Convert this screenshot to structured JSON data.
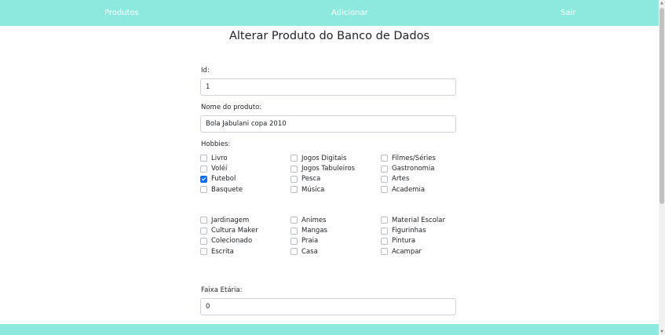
{
  "nav": {
    "produtos": "Produtos",
    "adicionar": "Adicionar",
    "sair": "Sair"
  },
  "page": {
    "title": "Alterar Produto do Banco de Dados"
  },
  "form": {
    "id_label": "Id:",
    "id_value": "1",
    "name_label": "Nome do produto:",
    "name_value": "Bola Jabulani copa 2010",
    "hobbies_label": "Hobbies:",
    "age_label": "Faixa Etária:",
    "age_value": "0"
  },
  "hobbies_group1": {
    "col1": [
      {
        "label": "Livro",
        "checked": false
      },
      {
        "label": "Voléi",
        "checked": false
      },
      {
        "label": "Futebol",
        "checked": true
      },
      {
        "label": "Basquete",
        "checked": false
      }
    ],
    "col2": [
      {
        "label": "Jogos Digitais",
        "checked": false
      },
      {
        "label": "Jogos Tabuleiros",
        "checked": false
      },
      {
        "label": "Pesca",
        "checked": false
      },
      {
        "label": "Música",
        "checked": false
      }
    ],
    "col3": [
      {
        "label": "Filmes/Séries",
        "checked": false
      },
      {
        "label": "Gastronomia",
        "checked": false
      },
      {
        "label": "Artes",
        "checked": false
      },
      {
        "label": "Academia",
        "checked": false
      }
    ]
  },
  "hobbies_group2": {
    "col1": [
      {
        "label": "Jardinagem",
        "checked": false
      },
      {
        "label": "Cultura Maker",
        "checked": false
      },
      {
        "label": "Colecionado",
        "checked": false
      },
      {
        "label": "Escrita",
        "checked": false
      }
    ],
    "col2": [
      {
        "label": "Animes",
        "checked": false
      },
      {
        "label": "Mangas",
        "checked": false
      },
      {
        "label": "Praia",
        "checked": false
      },
      {
        "label": "Casa",
        "checked": false
      }
    ],
    "col3": [
      {
        "label": "Material Escolar",
        "checked": false
      },
      {
        "label": "Figurinhas",
        "checked": false
      },
      {
        "label": "Pintura",
        "checked": false
      },
      {
        "label": "Acampar",
        "checked": false
      }
    ]
  },
  "colors": {
    "navbar": "#8de8dd",
    "checkbox_checked": "#0d6efd"
  }
}
